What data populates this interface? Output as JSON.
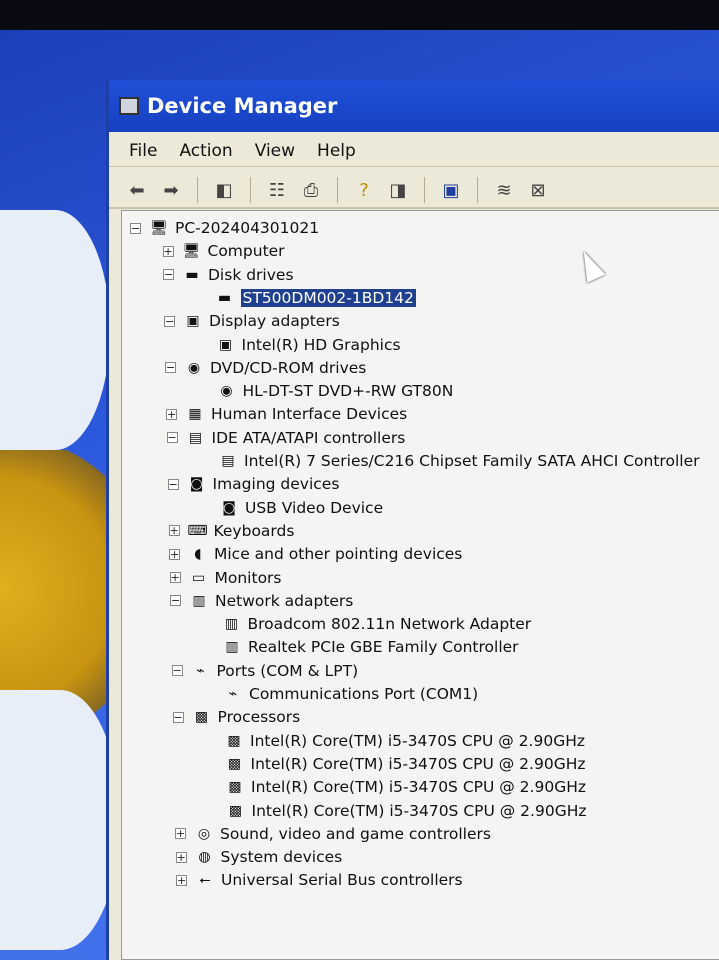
{
  "window": {
    "title": "Device Manager"
  },
  "menu": [
    "File",
    "Action",
    "View",
    "Help"
  ],
  "toolbar_icons": [
    "back-icon",
    "forward-icon",
    "show-hide-tree-icon",
    "properties-icon",
    "print-icon",
    "help-icon",
    "show-hide-action-pane-icon",
    "scan-hardware-icon",
    "update-driver-icon",
    "uninstall-icon"
  ],
  "tree": [
    {
      "label": "PC-202404301021",
      "level": 0,
      "exp": "-",
      "icon": "computer-icon",
      "glyph": "🖥"
    },
    {
      "label": "Computer",
      "level": 1,
      "exp": "+",
      "icon": "computer-icon",
      "glyph": "🖥"
    },
    {
      "label": "Disk drives",
      "level": 1,
      "exp": "-",
      "icon": "disk-drive-icon",
      "glyph": "▬"
    },
    {
      "label": "ST500DM002-1BD142",
      "level": 2,
      "exp": "",
      "icon": "disk-drive-icon",
      "glyph": "▬",
      "selected": true
    },
    {
      "label": "Display adapters",
      "level": 1,
      "exp": "-",
      "icon": "display-adapter-icon",
      "glyph": "▣"
    },
    {
      "label": "Intel(R) HD Graphics",
      "level": 2,
      "exp": "",
      "icon": "display-adapter-icon",
      "glyph": "▣"
    },
    {
      "label": "DVD/CD-ROM drives",
      "level": 1,
      "exp": "-",
      "icon": "dvd-drive-icon",
      "glyph": "◉"
    },
    {
      "label": "HL-DT-ST DVD+-RW GT80N",
      "level": 2,
      "exp": "",
      "icon": "dvd-drive-icon",
      "glyph": "◉"
    },
    {
      "label": "Human Interface Devices",
      "level": 1,
      "exp": "+",
      "icon": "hid-icon",
      "glyph": "▦"
    },
    {
      "label": "IDE ATA/ATAPI controllers",
      "level": 1,
      "exp": "-",
      "icon": "ide-controller-icon",
      "glyph": "▤"
    },
    {
      "label": "Intel(R) 7 Series/C216 Chipset Family SATA AHCI Controller",
      "level": 2,
      "exp": "",
      "icon": "ide-controller-icon",
      "glyph": "▤"
    },
    {
      "label": "Imaging devices",
      "level": 1,
      "exp": "-",
      "icon": "camera-icon",
      "glyph": "◙"
    },
    {
      "label": "USB Video Device",
      "level": 2,
      "exp": "",
      "icon": "camera-icon",
      "glyph": "◙"
    },
    {
      "label": "Keyboards",
      "level": 1,
      "exp": "+",
      "icon": "keyboard-icon",
      "glyph": "⌨"
    },
    {
      "label": "Mice and other pointing devices",
      "level": 1,
      "exp": "+",
      "icon": "mouse-icon",
      "glyph": "◖"
    },
    {
      "label": "Monitors",
      "level": 1,
      "exp": "+",
      "icon": "monitor-icon",
      "glyph": "▭"
    },
    {
      "label": "Network adapters",
      "level": 1,
      "exp": "-",
      "icon": "network-adapter-icon",
      "glyph": "▥"
    },
    {
      "label": "Broadcom 802.11n Network Adapter",
      "level": 2,
      "exp": "",
      "icon": "network-adapter-icon",
      "glyph": "▥"
    },
    {
      "label": "Realtek PCIe GBE Family Controller",
      "level": 2,
      "exp": "",
      "icon": "network-adapter-icon",
      "glyph": "▥"
    },
    {
      "label": "Ports (COM & LPT)",
      "level": 1,
      "exp": "-",
      "icon": "port-icon",
      "glyph": "⌁"
    },
    {
      "label": "Communications Port (COM1)",
      "level": 2,
      "exp": "",
      "icon": "port-icon",
      "glyph": "⌁"
    },
    {
      "label": "Processors",
      "level": 1,
      "exp": "-",
      "icon": "processor-icon",
      "glyph": "▩"
    },
    {
      "label": "Intel(R) Core(TM) i5-3470S CPU @ 2.90GHz",
      "level": 2,
      "exp": "",
      "icon": "processor-icon",
      "glyph": "▩"
    },
    {
      "label": "Intel(R) Core(TM) i5-3470S CPU @ 2.90GHz",
      "level": 2,
      "exp": "",
      "icon": "processor-icon",
      "glyph": "▩"
    },
    {
      "label": "Intel(R) Core(TM) i5-3470S CPU @ 2.90GHz",
      "level": 2,
      "exp": "",
      "icon": "processor-icon",
      "glyph": "▩"
    },
    {
      "label": "Intel(R) Core(TM) i5-3470S CPU @ 2.90GHz",
      "level": 2,
      "exp": "",
      "icon": "processor-icon",
      "glyph": "▩"
    },
    {
      "label": "Sound, video and game controllers",
      "level": 1,
      "exp": "+",
      "icon": "sound-icon",
      "glyph": "◎"
    },
    {
      "label": "System devices",
      "level": 1,
      "exp": "+",
      "icon": "system-device-icon",
      "glyph": "◍"
    },
    {
      "label": "Universal Serial Bus controllers",
      "level": 1,
      "exp": "+",
      "icon": "usb-icon",
      "glyph": "⭠"
    }
  ]
}
